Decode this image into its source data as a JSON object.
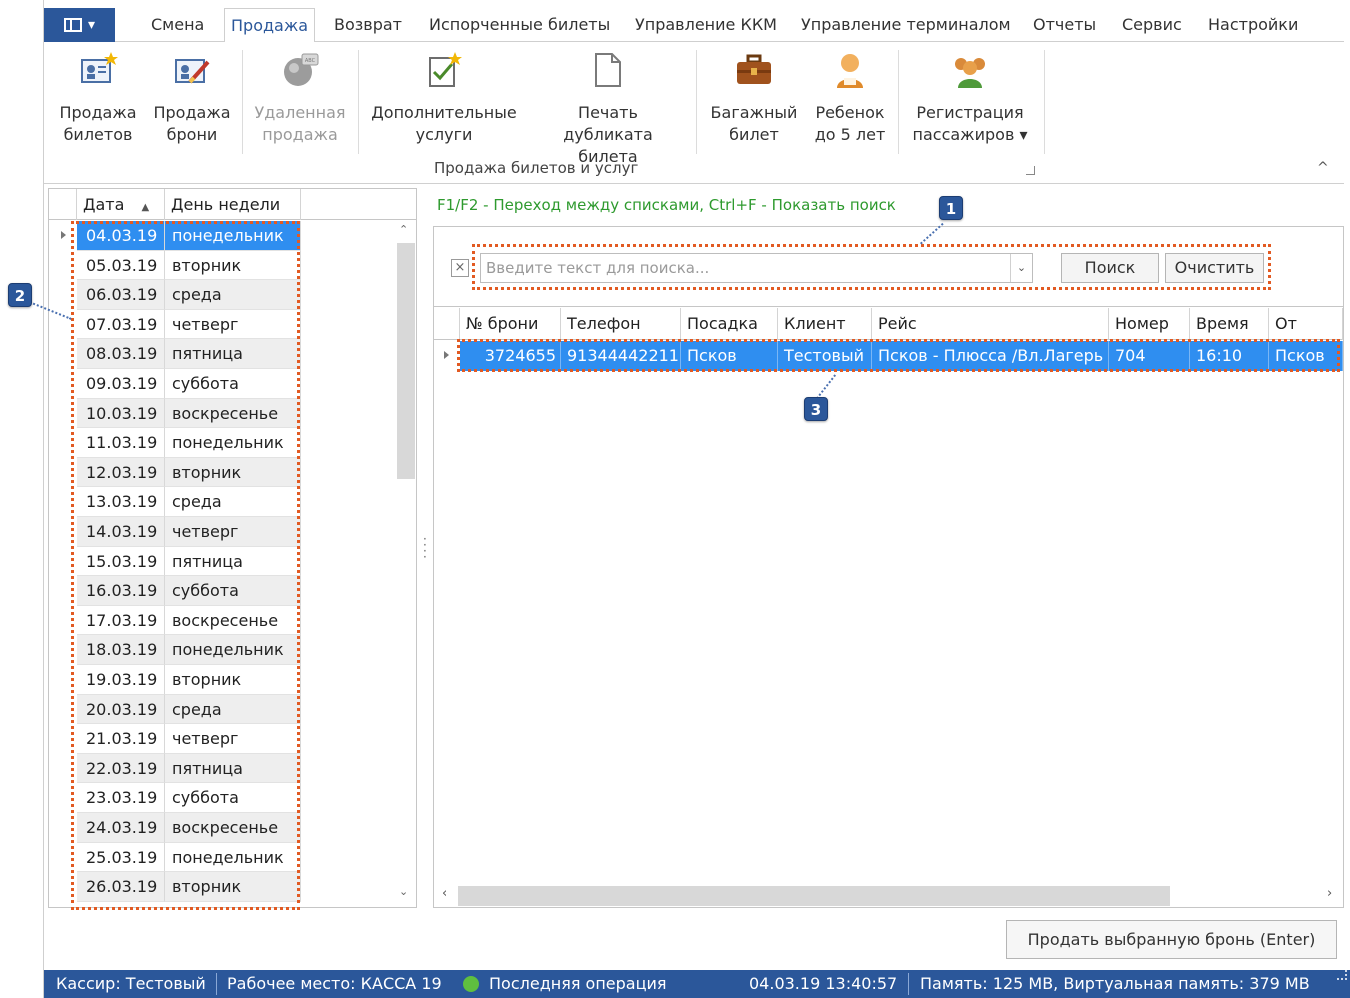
{
  "ribbon": {
    "app_button_label": "",
    "tabs": [
      "Смена",
      "Продажа",
      "Возврат",
      "Испорченные билеты",
      "Управление ККМ",
      "Управление терминалом",
      "Отчеты",
      "Сервис",
      "Настройки"
    ],
    "active_tab": "Продажа",
    "buttons": [
      {
        "line1": "Продажа",
        "line2": "билетов",
        "icon": "ticket-sale-icon",
        "enabled": true
      },
      {
        "line1": "Продажа",
        "line2": "брони",
        "icon": "reservation-sale-icon",
        "enabled": true
      },
      {
        "line1": "Удаленная",
        "line2": "продажа",
        "icon": "remote-sale-icon",
        "enabled": false
      },
      {
        "line1": "Дополнительные",
        "line2": "услуги",
        "icon": "extra-services-icon",
        "enabled": true
      },
      {
        "line1": "Печать дубликата",
        "line2": "билета",
        "icon": "print-duplicate-icon",
        "enabled": true
      },
      {
        "line1": "Багажный",
        "line2": "билет",
        "icon": "luggage-icon",
        "enabled": true
      },
      {
        "line1": "Ребенок",
        "line2": "до 5 лет",
        "icon": "child-icon",
        "enabled": true
      },
      {
        "line1": "Регистрация",
        "line2": "пассажиров ▾",
        "icon": "passengers-icon",
        "enabled": true
      }
    ],
    "group_label": "Продажа билетов и услуг",
    "collapse_glyph": "^"
  },
  "date_list": {
    "headers": {
      "date": "Дата",
      "sort_glyph": "▲",
      "weekday": "День недели"
    },
    "rows": [
      {
        "date": "04.03.19",
        "day": "понедельник"
      },
      {
        "date": "05.03.19",
        "day": "вторник"
      },
      {
        "date": "06.03.19",
        "day": "среда"
      },
      {
        "date": "07.03.19",
        "day": "четверг"
      },
      {
        "date": "08.03.19",
        "day": "пятница"
      },
      {
        "date": "09.03.19",
        "day": "суббота"
      },
      {
        "date": "10.03.19",
        "day": "воскресенье"
      },
      {
        "date": "11.03.19",
        "day": "понедельник"
      },
      {
        "date": "12.03.19",
        "day": "вторник"
      },
      {
        "date": "13.03.19",
        "day": "среда"
      },
      {
        "date": "14.03.19",
        "day": "четверг"
      },
      {
        "date": "15.03.19",
        "day": "пятница"
      },
      {
        "date": "16.03.19",
        "day": "суббота"
      },
      {
        "date": "17.03.19",
        "day": "воскресенье"
      },
      {
        "date": "18.03.19",
        "day": "понедельник"
      },
      {
        "date": "19.03.19",
        "day": "вторник"
      },
      {
        "date": "20.03.19",
        "day": "среда"
      },
      {
        "date": "21.03.19",
        "day": "четверг"
      },
      {
        "date": "22.03.19",
        "day": "пятница"
      },
      {
        "date": "23.03.19",
        "day": "суббота"
      },
      {
        "date": "24.03.19",
        "day": "воскресенье"
      },
      {
        "date": "25.03.19",
        "day": "понедельник"
      },
      {
        "date": "26.03.19",
        "day": "вторник"
      }
    ],
    "selected_index": 0
  },
  "hint_text": "F1/F2 - Переход между списками,  Ctrl+F - Показать поиск",
  "search": {
    "close_glyph": "×",
    "placeholder": "Введите текст для поиска...",
    "dropdown_glyph": "⌄",
    "search_button": "Поиск",
    "clear_button": "Очистить"
  },
  "reservations": {
    "columns": [
      "№ брони",
      "Телефон",
      "Посадка",
      "Клиент",
      "Рейс",
      "Номер",
      "Время",
      "От"
    ],
    "rows": [
      {
        "id": "3724655",
        "phone": "91344442211",
        "boarding": "Псков",
        "client": "Тестовый",
        "route": "Псков - Плюсса /Вл.Лагерь",
        "number": "704",
        "time": "16:10",
        "from": "Псков"
      }
    ]
  },
  "sell_button": "Продать выбранную бронь (Enter)",
  "status_bar": {
    "cashier": "Кассир: Тестовый",
    "workplace": "Рабочее место: КАССА 19",
    "last_operation": "Последняя операция",
    "datetime": "04.03.19 13:40:57",
    "memory": "Память: 125 MB, Виртуальная память: 379 MB"
  },
  "annotations": {
    "m1": "1",
    "m2": "2",
    "m3": "3"
  },
  "colors": {
    "accent": "#2b579a",
    "selection": "#2f8ef0",
    "hint": "#2e9a2e",
    "annotation_box": "#e25a22"
  }
}
